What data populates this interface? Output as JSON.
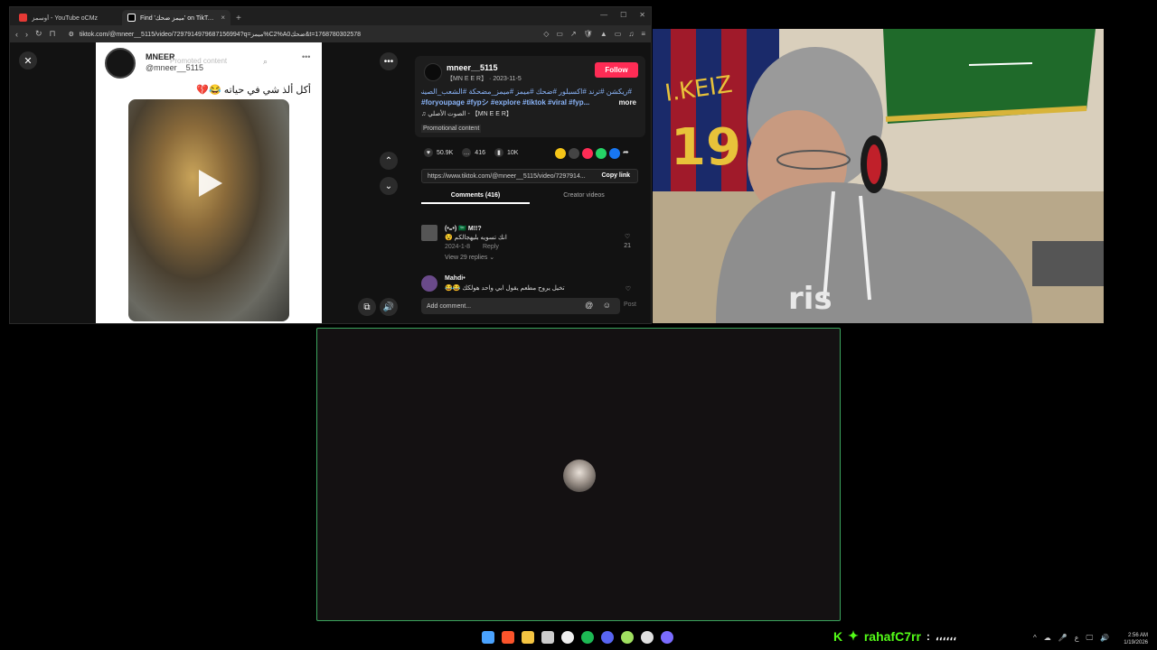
{
  "browser": {
    "tabs": [
      {
        "title": "أوسمز - YouTube oCMz",
        "icon": "youtube-icon",
        "color": "#e53935",
        "close": "×"
      },
      {
        "title": "Find 'ميمز ضحك' on TikTok | Tik",
        "icon": "tiktok-icon",
        "color": "#ffffff",
        "close": "×"
      }
    ],
    "new_tab": "+",
    "window_controls": [
      "—",
      "☐",
      "✕"
    ],
    "url": "tiktok.com/@mneer__5115/video/7297914979687156994?q=ميمز%C2%A0ضحك&t=1768780302578",
    "nav": {
      "back": "‹",
      "forward": "›",
      "reload": "↻",
      "bookmark": "⊓"
    },
    "toolbar_icons": [
      "◇",
      "▭",
      "↗",
      "🛡",
      "▲",
      "▭",
      "♫",
      "≡"
    ]
  },
  "video_card": {
    "close": "✕",
    "name": "MNEER",
    "handle": "@mneer__5115",
    "promo_overlay": "Promoted content",
    "search_glyph": "⌕",
    "dots": "•••",
    "caption": "أكل ألذ شي في حياته 😂💔",
    "more_button": "•••",
    "nav_up": "⌃",
    "nav_down": "⌄",
    "pip_glyph": "⧉",
    "volume_glyph": "🔊"
  },
  "info": {
    "username": "mneer__5115",
    "subline": "【MN E E R】 · 2023-11-5",
    "follow": "Follow",
    "hashtags_ar": "#ريكشن #ترند #اكسبلور #ضحك #ميمز #ميمز_مضحكة #الشعب_الصيني_ماله_حل",
    "hashtags_en": "#foryoupage #fypシ #explore #tiktok #viral #fyp...",
    "more": "more",
    "music": "♫  الصوت الأصلي - 【MN E E R】",
    "promotional": "Promotional content"
  },
  "stats": {
    "likes": "50.9K",
    "comments": "416",
    "saves": "10K",
    "share_colors": [
      "#f5c518",
      "#444444",
      "#fe2c55",
      "#25d366",
      "#1877f2"
    ],
    "forward": "➦"
  },
  "link": {
    "url": "https://www.tiktok.com/@mneer__5115/video/7297914...",
    "copy": "Copy link"
  },
  "comment_tabs": [
    "Comments (416)",
    "Creator videos"
  ],
  "comments": [
    {
      "user": "(•₌•) 🇸🇦 M!!?",
      "text": "😵 انك تسويه بليهجالكم",
      "date": "2024-1-8",
      "reply": "Reply",
      "replies": "View 29 replies ⌄",
      "likes": "21"
    },
    {
      "user": "Mahdi•",
      "text": "😂😂 تخيل يروح مطعم يقول ابي واحد هولكك",
      "date": "",
      "reply": "",
      "replies": "",
      "likes": ""
    }
  ],
  "add_comment": {
    "placeholder": "Add comment...",
    "icons": "@ ☺",
    "post": "Post"
  },
  "chat_overlay": {
    "badge": "K",
    "emote": "✦",
    "username": "rahafC7rr",
    "separator": " : ",
    "message": "،،،،،،"
  },
  "taskbar": {
    "app_colors": [
      "#4aa3ff",
      "#fb542b",
      "#f5c542",
      "#cccccc",
      "#eeeeee",
      "#1db954",
      "#5865f2",
      "#a0e060",
      "#e0e0e0",
      "#7b6cff"
    ],
    "tray": [
      "^",
      "☁",
      "🎤",
      "ع",
      "🖵",
      "🔊"
    ],
    "time": "2:56 AM",
    "date": "1/19/2026"
  }
}
